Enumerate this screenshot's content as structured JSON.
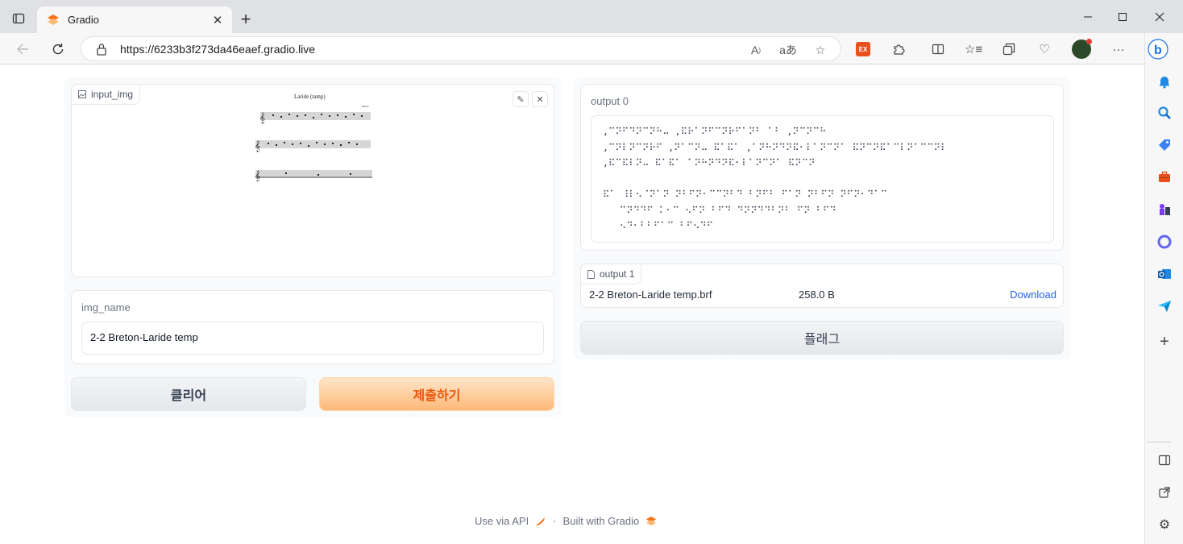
{
  "browser": {
    "tab_title": "Gradio",
    "url": "https://6233b3f273da46eaef.gradio.live"
  },
  "input_img": {
    "label": "input_img",
    "sheet_title": "Laride (tamp)"
  },
  "img_name": {
    "label": "img_name",
    "value": "2-2 Breton-Laride temp"
  },
  "buttons": {
    "clear": "클리어",
    "submit": "제출하기",
    "flag": "플래그"
  },
  "output0": {
    "label": "output 0",
    "text": ",⠉⠝⠋⠙⠝⠉⠝⠓⠤ ,⠯⠗⠁⠝⠋⠉⠝⠗⠋⠁⠝⠃ ⠁⠃ ,⠝⠉⠝⠉⠓\n,⠉⠝⠇⠝⠉⠝⠗⠋ ,⠝⠁⠉⠝⠤ ⠯⠁⠯⠁ ,⠁⠝⠓⠝⠙⠝⠯⠂⠇⠁⠝⠉⠝⠁ ⠯⠝⠉⠝⠯⠁⠉⠇⠝⠁⠉⠉⠝⠇\n,⠯⠉⠯⠇⠝⠤ ⠯⠁⠯⠁ ⠁⠝⠓⠝⠙⠝⠯⠂⠇⠁⠝⠉⠝⠁ ⠯⠝⠉⠝\n\n⠯⠁ ⠸⠇⠢⠈⠝⠁⠝ ⠝⠃⠋⠝⠂⠉⠉⠝⠃⠙ ⠃⠝⠋⠃ ⠋⠁⠝ ⠝⠃⠋⠝ ⠝⠋⠝⠂⠙⠁⠉\n   ⠉⠝⠙⠙⠋ ⠅⠂⠉ ⠢⠋⠝ ⠃⠋⠙ ⠙⠝⠝⠙⠙⠃⠝⠃ ⠋⠝ ⠃⠋⠙\n   ⠢⠙⠂⠃⠃⠋⠁⠉ ⠃⠋⠢⠙⠋"
  },
  "output1": {
    "label": "output 1",
    "file_name": "2-2 Breton-Laride temp.brf",
    "file_size": "258.0 B",
    "download": "Download"
  },
  "footer": {
    "api": "Use via API",
    "dot": "·",
    "built": "Built with Gradio"
  },
  "colors": {
    "accent_orange": "#ea580c",
    "link_blue": "#2563eb"
  }
}
